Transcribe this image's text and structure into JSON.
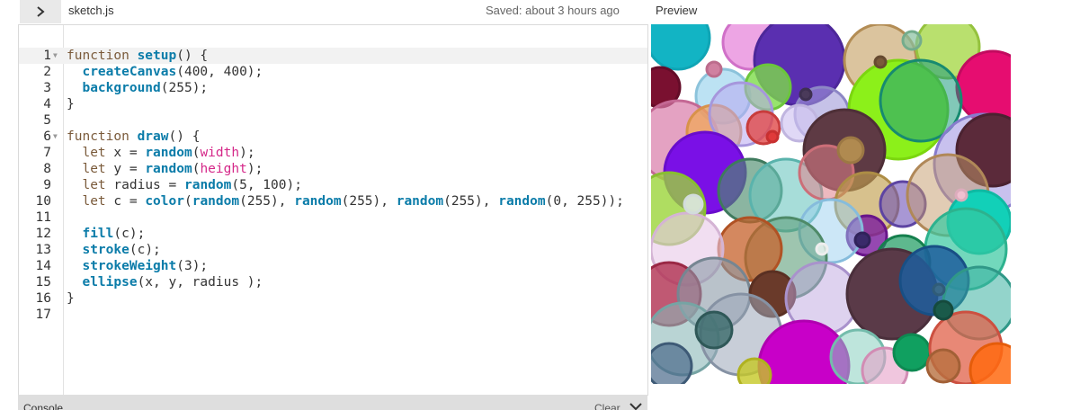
{
  "header": {
    "file_name": "sketch.js",
    "saved_status": "Saved: about 3 hours ago",
    "preview_label": "Preview"
  },
  "editor": {
    "active_line": 1,
    "lines": [
      {
        "n": "1",
        "fold": true,
        "tokens": [
          [
            "kw",
            "function "
          ],
          [
            "fn",
            "setup"
          ],
          [
            "t",
            "() {"
          ]
        ]
      },
      {
        "n": "2",
        "fold": false,
        "tokens": [
          [
            "t",
            "  "
          ],
          [
            "fn",
            "createCanvas"
          ],
          [
            "t",
            "(400, 400);"
          ]
        ]
      },
      {
        "n": "3",
        "fold": false,
        "tokens": [
          [
            "t",
            "  "
          ],
          [
            "fn",
            "background"
          ],
          [
            "t",
            "(255);"
          ]
        ]
      },
      {
        "n": "4",
        "fold": false,
        "tokens": [
          [
            "t",
            "}"
          ]
        ]
      },
      {
        "n": "5",
        "fold": false,
        "tokens": []
      },
      {
        "n": "6",
        "fold": true,
        "tokens": [
          [
            "kw",
            "function "
          ],
          [
            "fn",
            "draw"
          ],
          [
            "t",
            "() {"
          ]
        ]
      },
      {
        "n": "7",
        "fold": false,
        "tokens": [
          [
            "t",
            "  "
          ],
          [
            "kw",
            "let"
          ],
          [
            "t",
            " x = "
          ],
          [
            "fn",
            "random"
          ],
          [
            "t",
            "("
          ],
          [
            "arg",
            "width"
          ],
          [
            "t",
            ");"
          ]
        ]
      },
      {
        "n": "8",
        "fold": false,
        "tokens": [
          [
            "t",
            "  "
          ],
          [
            "kw",
            "let"
          ],
          [
            "t",
            " y = "
          ],
          [
            "fn",
            "random"
          ],
          [
            "t",
            "("
          ],
          [
            "arg",
            "height"
          ],
          [
            "t",
            ");"
          ]
        ]
      },
      {
        "n": "9",
        "fold": false,
        "tokens": [
          [
            "t",
            "  "
          ],
          [
            "kw",
            "let"
          ],
          [
            "t",
            " radius = "
          ],
          [
            "fn",
            "random"
          ],
          [
            "t",
            "(5, 100);"
          ]
        ]
      },
      {
        "n": "10",
        "fold": false,
        "tokens": [
          [
            "t",
            "  "
          ],
          [
            "kw",
            "let"
          ],
          [
            "t",
            " c = "
          ],
          [
            "fn",
            "color"
          ],
          [
            "t",
            "("
          ],
          [
            "fn",
            "random"
          ],
          [
            "t",
            "(255), "
          ],
          [
            "fn",
            "random"
          ],
          [
            "t",
            "(255), "
          ],
          [
            "fn",
            "random"
          ],
          [
            "t",
            "(255), "
          ],
          [
            "fn",
            "random"
          ],
          [
            "t",
            "(0, 255));"
          ]
        ]
      },
      {
        "n": "11",
        "fold": false,
        "tokens": []
      },
      {
        "n": "12",
        "fold": false,
        "tokens": [
          [
            "t",
            "  "
          ],
          [
            "fn",
            "fill"
          ],
          [
            "t",
            "(c);"
          ]
        ]
      },
      {
        "n": "13",
        "fold": false,
        "tokens": [
          [
            "t",
            "  "
          ],
          [
            "fn",
            "stroke"
          ],
          [
            "t",
            "(c);"
          ]
        ]
      },
      {
        "n": "14",
        "fold": false,
        "tokens": [
          [
            "t",
            "  "
          ],
          [
            "fn",
            "strokeWeight"
          ],
          [
            "t",
            "(3);"
          ]
        ]
      },
      {
        "n": "15",
        "fold": false,
        "tokens": [
          [
            "t",
            "  "
          ],
          [
            "fn",
            "ellipse"
          ],
          [
            "t",
            "(x, y, radius );"
          ]
        ]
      },
      {
        "n": "16",
        "fold": false,
        "tokens": [
          [
            "t",
            "}"
          ]
        ]
      },
      {
        "n": "17",
        "fold": false,
        "tokens": []
      }
    ]
  },
  "console": {
    "label": "Console",
    "clear_label": "Clear"
  },
  "icons": {
    "toggle": "chevron-right-icon",
    "fold": "fold-arrow-icon",
    "console_collapse": "chevron-down-icon"
  },
  "colors": {
    "keyword": "#7a5a3a",
    "function": "#0b7ca9",
    "argument": "#d52889",
    "console_bar": "#dedede"
  }
}
